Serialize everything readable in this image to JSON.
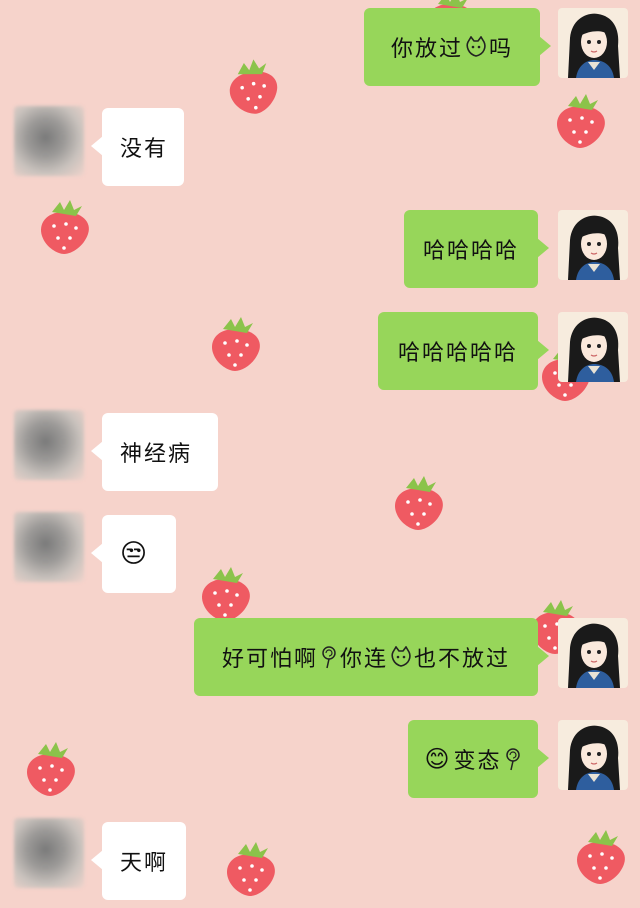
{
  "chat": {
    "messages": [
      {
        "side": "me",
        "parts": [
          "你放过",
          "cat-face-icon",
          "吗"
        ]
      },
      {
        "side": "them",
        "text": "没有"
      },
      {
        "side": "me",
        "text": "哈哈哈哈"
      },
      {
        "side": "me",
        "text": "哈哈哈哈哈"
      },
      {
        "side": "them",
        "text": "神经病"
      },
      {
        "side": "them",
        "emoji": "😒"
      },
      {
        "side": "me",
        "parts": [
          "好可怕啊",
          "lollipop-icon",
          "你连",
          "cat-face-icon",
          "也不放过"
        ]
      },
      {
        "side": "me",
        "parts": [
          "😊",
          "变态",
          "lollipop-icon"
        ]
      },
      {
        "side": "them",
        "text": "天啊"
      }
    ],
    "m1": {
      "a": "你放过",
      "b": "吗"
    },
    "m2": "没有",
    "m3": "哈哈哈哈",
    "m4": "哈哈哈哈哈",
    "m5": "神经病",
    "m6": "😒",
    "m7": {
      "a": "好可怕啊",
      "b": "你连",
      "c": "也不放过"
    },
    "m8": {
      "emoji": "😊",
      "text": "变态"
    },
    "m9": "天啊"
  },
  "colors": {
    "background": "#f6d3cb",
    "my_bubble": "#97d65a",
    "their_bubble": "#ffffff",
    "strawberry": "#ef5a62"
  }
}
